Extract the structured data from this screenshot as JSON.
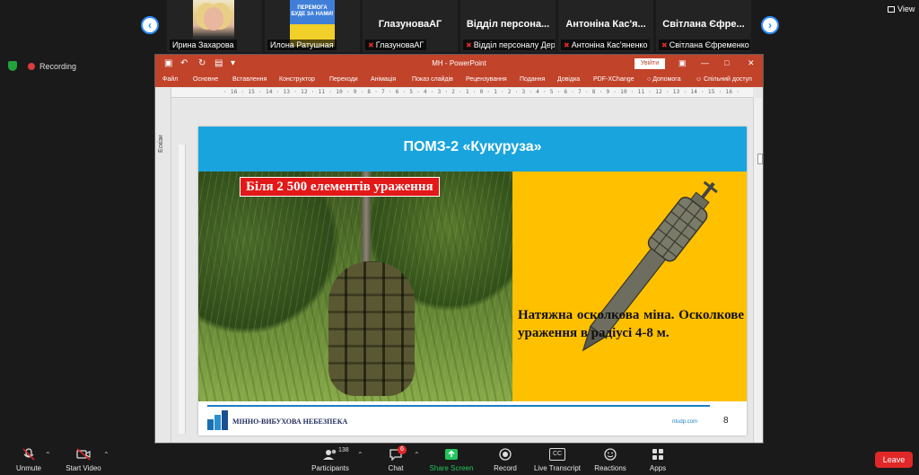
{
  "gallery": {
    "prev_glyph": "‹",
    "next_glyph": "›",
    "tiles": [
      {
        "label": "Ирина Захарова",
        "big": "",
        "muted": false
      },
      {
        "label": "Илона Ратушная",
        "big": "",
        "muted": false,
        "flag_text": "ПЕРЕМОГА БУДЕ ЗА НАМИ!"
      },
      {
        "label": "ГлазуноваАГ",
        "big": "ГлазуноваАГ",
        "muted": true
      },
      {
        "label": "Відділ персоналу Дер...",
        "big": "Відділ персона...",
        "muted": true
      },
      {
        "label": "Антоніна Кас'яненко",
        "big": "Антоніна Кас'я...",
        "muted": true
      },
      {
        "label": "Світлана Єфременко",
        "big": "Світлана Єфре...",
        "muted": true
      }
    ],
    "view_label": "View"
  },
  "meeting": {
    "recording_label": "Recording"
  },
  "powerpoint": {
    "window_title": "МН  -  PowerPoint",
    "signin_label": "Увійти",
    "ribbon_tabs": [
      "Файл",
      "Основне",
      "Вставлення",
      "Конструктор",
      "Переходи",
      "Анімація",
      "Показ слайдів",
      "Рецензування",
      "Подання",
      "Довідка",
      "PDF-XChange",
      "Допомога",
      "Спільний доступ"
    ],
    "ruler_text": "· 16 · 15 · 14 · 13 · 12 · 11 · 10 · 9 · 8 · 7 · 6 · 5 · 4 · 3 · 2 · 1 · 0 · 1 · 2 · 3 · 4 · 5 · 6 · 7 · 8 · 9 · 10 · 11 · 12 · 13 · 14 · 15 · 16 ·",
    "side_pane_label": "Ескізи"
  },
  "slide": {
    "title": "ПОМЗ-2 «Кукуруза»",
    "badge": "Біля 2 500 елементів ураження",
    "description": "Натяжна осколкова міна. Осколкове ураження в радіусі 4-8 м.",
    "footer_text": "МІННО-ВИБУХОВА НЕБЕЗПЕКА",
    "footer_url": "ntudp.com",
    "page_number": "8",
    "colors": {
      "header": "#1aa4dd",
      "panel": "#ffc000",
      "badge": "#e31818"
    }
  },
  "toolbar": {
    "unmute": "Unmute",
    "start_video": "Start Video",
    "participants": "Participants",
    "participants_count": "138",
    "chat": "Chat",
    "chat_badge": "6",
    "share_screen": "Share Screen",
    "record": "Record",
    "live_transcript": "Live Transcript",
    "live_transcript_icon": "CC",
    "reactions": "Reactions",
    "apps": "Apps",
    "leave": "Leave",
    "colors": {
      "share": "#22c55e",
      "leave": "#e02828"
    }
  }
}
